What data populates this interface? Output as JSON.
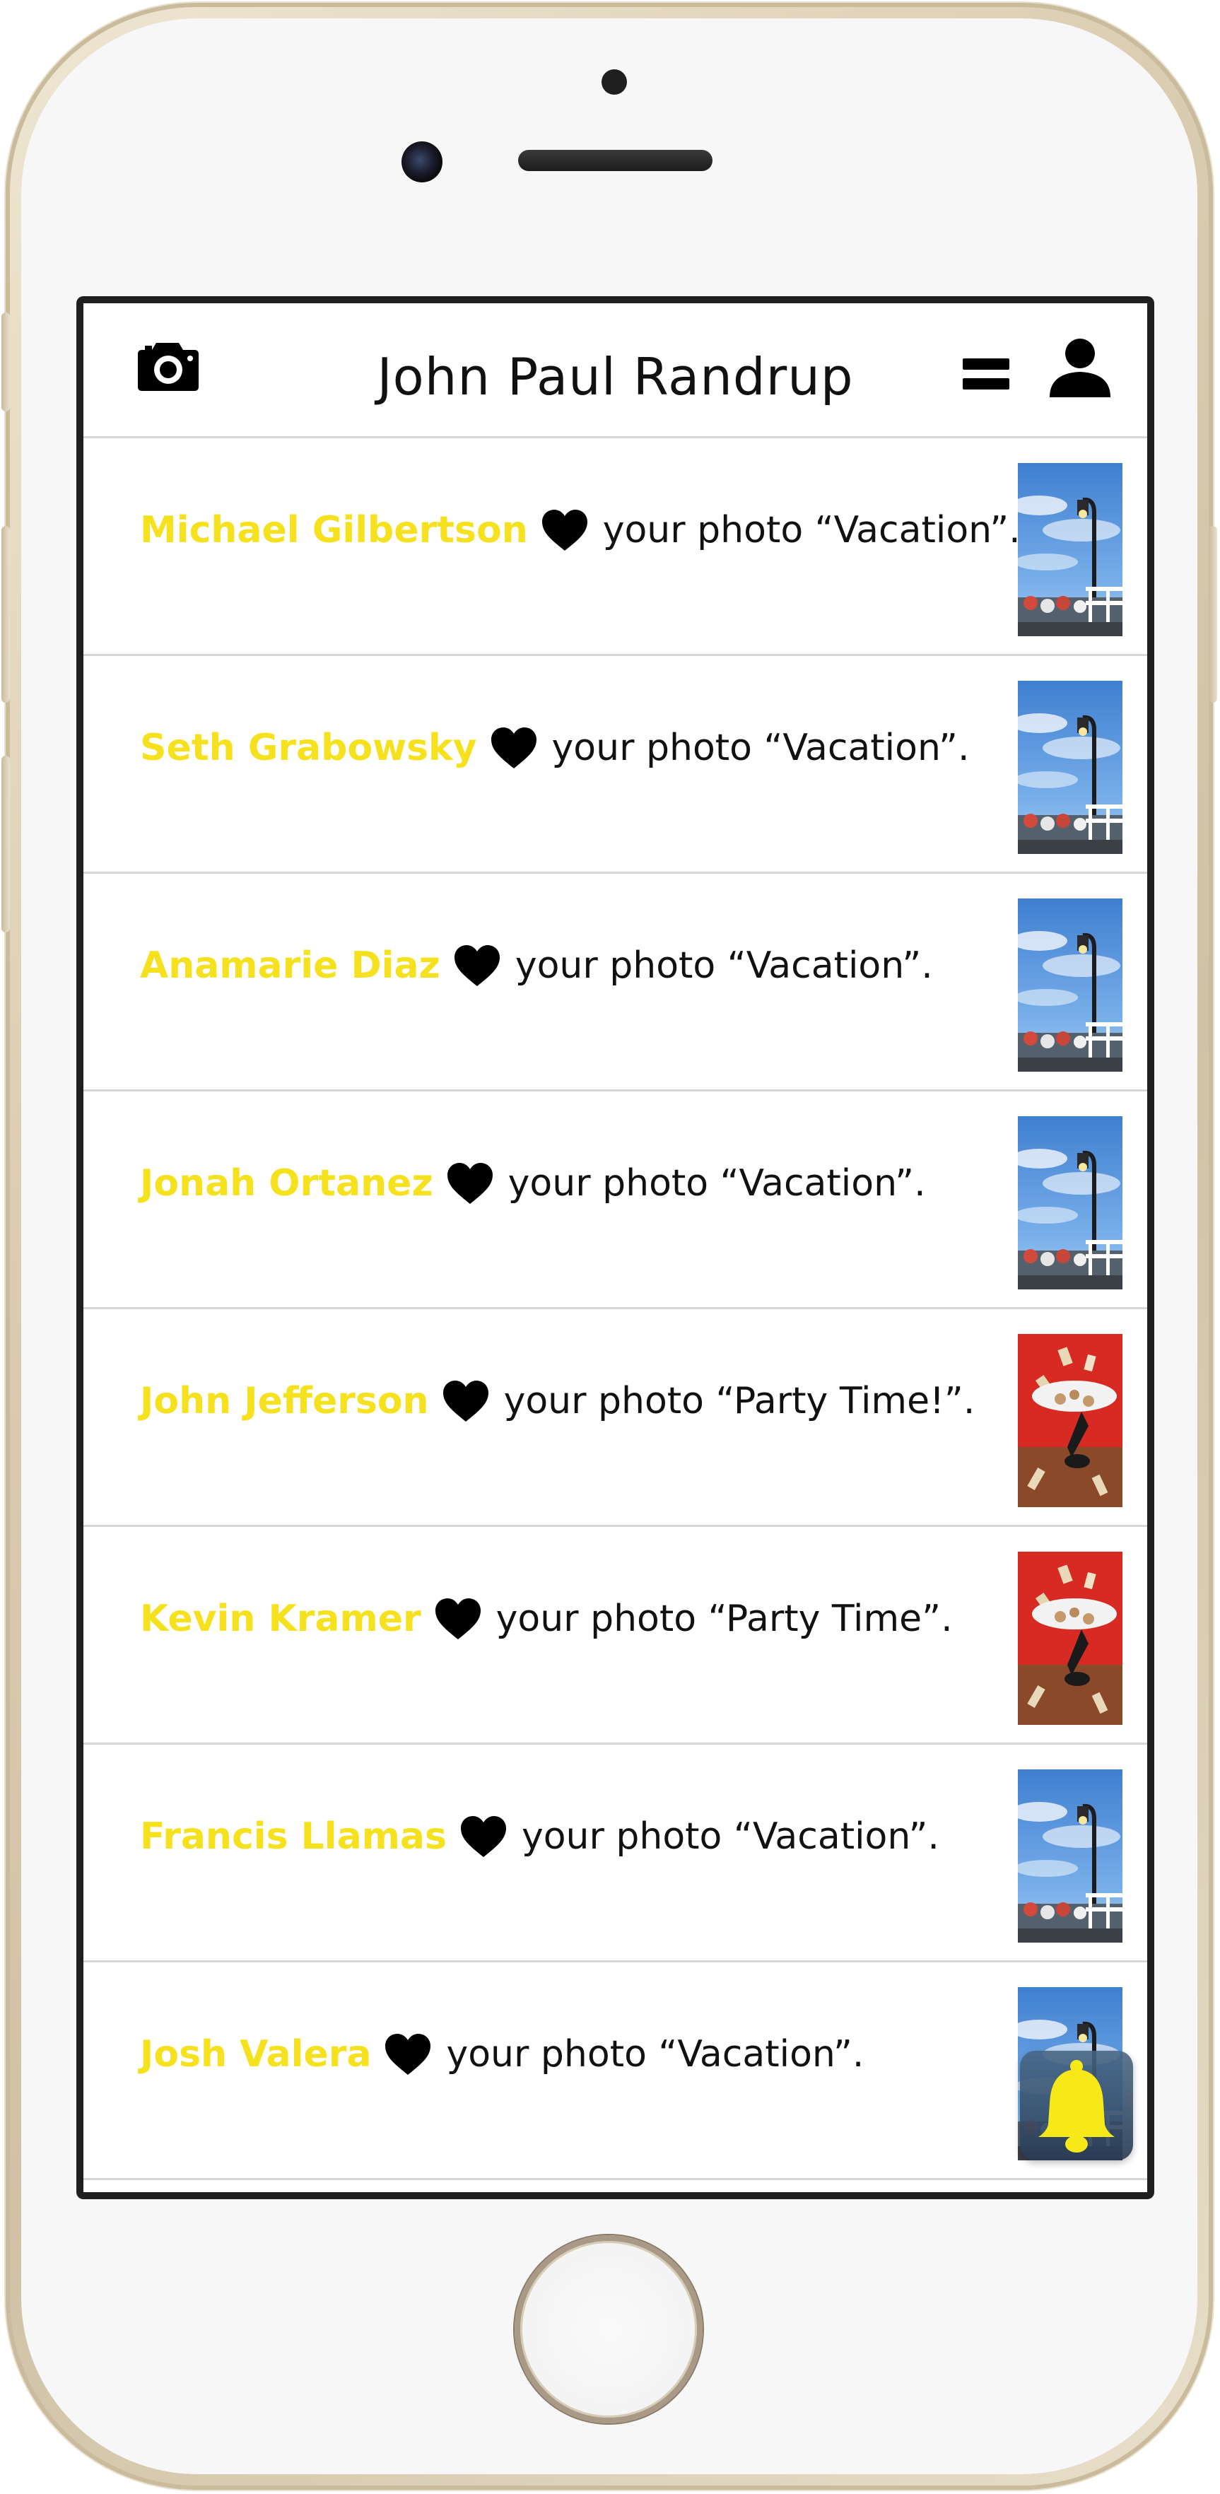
{
  "header": {
    "title": "John Paul Randrup"
  },
  "notifications": [
    {
      "name": "Michael Gilbertson",
      "action": "your photo “Vacation”.",
      "thumbnail": "vacation"
    },
    {
      "name": "Seth Grabowsky",
      "action": "your photo “Vacation”.",
      "thumbnail": "vacation"
    },
    {
      "name": "Anamarie Diaz",
      "action": "your photo “Vacation”.",
      "thumbnail": "vacation"
    },
    {
      "name": "Jonah Ortanez",
      "action": "your photo “Vacation”.",
      "thumbnail": "vacation"
    },
    {
      "name": "John Jefferson",
      "action": "your photo “Party Time!”.",
      "thumbnail": "party"
    },
    {
      "name": "Kevin Kramer",
      "action": "your photo “Party Time”.",
      "thumbnail": "party"
    },
    {
      "name": "Francis Llamas",
      "action": "your photo “Vacation”.",
      "thumbnail": "vacation"
    },
    {
      "name": "Josh Valera",
      "action": "your photo “Vacation”.",
      "thumbnail": "vacation"
    }
  ],
  "icons": {
    "header_left": "camera-icon",
    "header_right_1": "menu-icon",
    "header_right_2": "user-icon",
    "row_icon": "heart-icon",
    "floating": "bell-icon"
  },
  "colors": {
    "name": "#f5e11e",
    "text": "#111111",
    "divider": "#d6d6d6",
    "bell": "#f7e81a"
  }
}
